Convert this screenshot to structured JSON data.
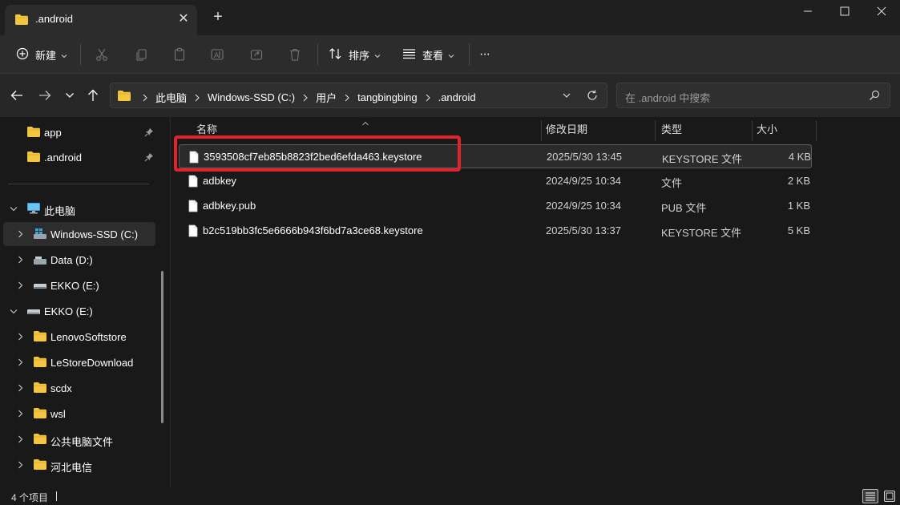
{
  "window": {
    "tab_title": ".android",
    "tab_close": "✕",
    "new_tab": "+"
  },
  "toolbar": {
    "new_label": "新建",
    "sort_label": "排序",
    "view_label": "查看",
    "more_label": "···"
  },
  "address": {
    "breadcrumbs": [
      "此电脑",
      "Windows-SSD (C:)",
      "用户",
      "tangbingbing",
      ".android"
    ],
    "search_placeholder": "在 .android 中搜索"
  },
  "sidebar": {
    "pinned": [
      {
        "label": "app"
      },
      {
        "label": ".android"
      }
    ],
    "tree": [
      {
        "label": "此电脑",
        "icon": "pc-icon"
      },
      {
        "label": "Windows-SSD (C:)",
        "icon": "windows-drive-icon"
      },
      {
        "label": "Data (D:)",
        "icon": "drive-icon"
      },
      {
        "label": "EKKO (E:)",
        "icon": "usb-drive-icon"
      },
      {
        "label": "EKKO (E:)",
        "icon": "usb-drive-icon"
      },
      {
        "label": "LenovoSoftstore",
        "icon": "folder-icon"
      },
      {
        "label": "LeStoreDownload",
        "icon": "folder-icon"
      },
      {
        "label": "scdx",
        "icon": "folder-icon"
      },
      {
        "label": "wsl",
        "icon": "folder-icon"
      },
      {
        "label": "公共电脑文件",
        "icon": "folder-icon"
      },
      {
        "label": "河北电信",
        "icon": "folder-icon"
      }
    ]
  },
  "columns": {
    "name": "名称",
    "modified": "修改日期",
    "type": "类型",
    "size": "大小"
  },
  "files": [
    {
      "name": "3593508cf7eb85b8823f2bed6efda463.keystore",
      "modified": "2025/5/30 13:45",
      "type": "KEYSTORE 文件",
      "size": "4 KB"
    },
    {
      "name": "adbkey",
      "modified": "2024/9/25 10:34",
      "type": "文件",
      "size": "2 KB"
    },
    {
      "name": "adbkey.pub",
      "modified": "2024/9/25 10:34",
      "type": "PUB 文件",
      "size": "1 KB"
    },
    {
      "name": "b2c519bb3fc5e6666b943f6bd7a3ce68.keystore",
      "modified": "2025/5/30 13:37",
      "type": "KEYSTORE 文件",
      "size": "5 KB"
    }
  ],
  "status": {
    "item_count": "4 个项目"
  },
  "colors": {
    "folder": "#f4c53e",
    "highlight": "#e0242a",
    "background": "#191919"
  }
}
